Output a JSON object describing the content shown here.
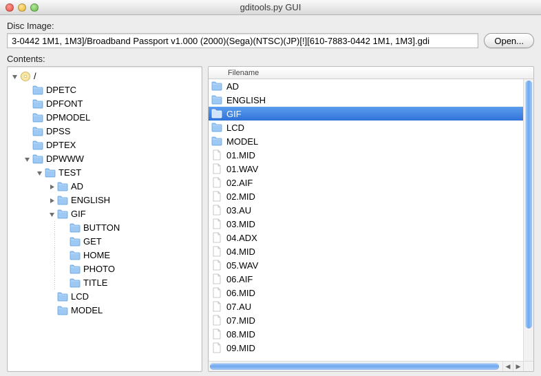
{
  "window": {
    "title": "gditools.py GUI"
  },
  "disc": {
    "label": "Disc Image:",
    "path": "3-0442 1M1, 1M3]/Broadband Passport v1.000 (2000)(Sega)(NTSC)(JP)[!][610-7883-0442 1M1, 1M3].gdi",
    "open_button": "Open..."
  },
  "contents": {
    "label": "Contents:"
  },
  "list": {
    "header": "Filename",
    "selected_index": 2,
    "items": [
      {
        "name": "AD",
        "type": "folder"
      },
      {
        "name": "ENGLISH",
        "type": "folder"
      },
      {
        "name": "GIF",
        "type": "folder"
      },
      {
        "name": "LCD",
        "type": "folder"
      },
      {
        "name": "MODEL",
        "type": "folder"
      },
      {
        "name": "01.MID",
        "type": "file"
      },
      {
        "name": "01.WAV",
        "type": "file"
      },
      {
        "name": "02.AIF",
        "type": "file"
      },
      {
        "name": "02.MID",
        "type": "file"
      },
      {
        "name": "03.AU",
        "type": "file"
      },
      {
        "name": "03.MID",
        "type": "file"
      },
      {
        "name": "04.ADX",
        "type": "file"
      },
      {
        "name": "04.MID",
        "type": "file"
      },
      {
        "name": "05.WAV",
        "type": "file"
      },
      {
        "name": "06.AIF",
        "type": "file"
      },
      {
        "name": "06.MID",
        "type": "file"
      },
      {
        "name": "07.AU",
        "type": "file"
      },
      {
        "name": "07.MID",
        "type": "file"
      },
      {
        "name": "08.MID",
        "type": "file"
      },
      {
        "name": "09.MID",
        "type": "file"
      }
    ]
  },
  "tree": [
    {
      "depth": 0,
      "icon": "disc",
      "label": "/",
      "disclosure": "open"
    },
    {
      "depth": 1,
      "icon": "folder",
      "label": "DPETC",
      "disclosure": "none"
    },
    {
      "depth": 1,
      "icon": "folder",
      "label": "DPFONT",
      "disclosure": "none"
    },
    {
      "depth": 1,
      "icon": "folder",
      "label": "DPMODEL",
      "disclosure": "none"
    },
    {
      "depth": 1,
      "icon": "folder",
      "label": "DPSS",
      "disclosure": "none"
    },
    {
      "depth": 1,
      "icon": "folder",
      "label": "DPTEX",
      "disclosure": "none"
    },
    {
      "depth": 1,
      "icon": "folder",
      "label": "DPWWW",
      "disclosure": "open"
    },
    {
      "depth": 2,
      "icon": "folder",
      "label": "TEST",
      "disclosure": "open"
    },
    {
      "depth": 3,
      "icon": "folder",
      "label": "AD",
      "disclosure": "closed"
    },
    {
      "depth": 3,
      "icon": "folder",
      "label": "ENGLISH",
      "disclosure": "closed"
    },
    {
      "depth": 3,
      "icon": "folder",
      "label": "GIF",
      "disclosure": "open"
    },
    {
      "depth": 4,
      "icon": "folder",
      "label": "BUTTON",
      "disclosure": "none",
      "guide": true
    },
    {
      "depth": 4,
      "icon": "folder",
      "label": "GET",
      "disclosure": "none",
      "guide": true
    },
    {
      "depth": 4,
      "icon": "folder",
      "label": "HOME",
      "disclosure": "none",
      "guide": true
    },
    {
      "depth": 4,
      "icon": "folder",
      "label": "PHOTO",
      "disclosure": "none",
      "guide": true
    },
    {
      "depth": 4,
      "icon": "folder",
      "label": "TITLE",
      "disclosure": "none",
      "guide": true
    },
    {
      "depth": 3,
      "icon": "folder",
      "label": "LCD",
      "disclosure": "none"
    },
    {
      "depth": 3,
      "icon": "folder",
      "label": "MODEL",
      "disclosure": "none"
    }
  ],
  "icons": {
    "folder": "folder-icon",
    "file": "file-icon",
    "disc": "disc-icon"
  },
  "colors": {
    "selection_top": "#5b9eef",
    "selection_bottom": "#2f72d8",
    "folder_fill": "#9ec9f4",
    "folder_stroke": "#5a9cd6"
  }
}
